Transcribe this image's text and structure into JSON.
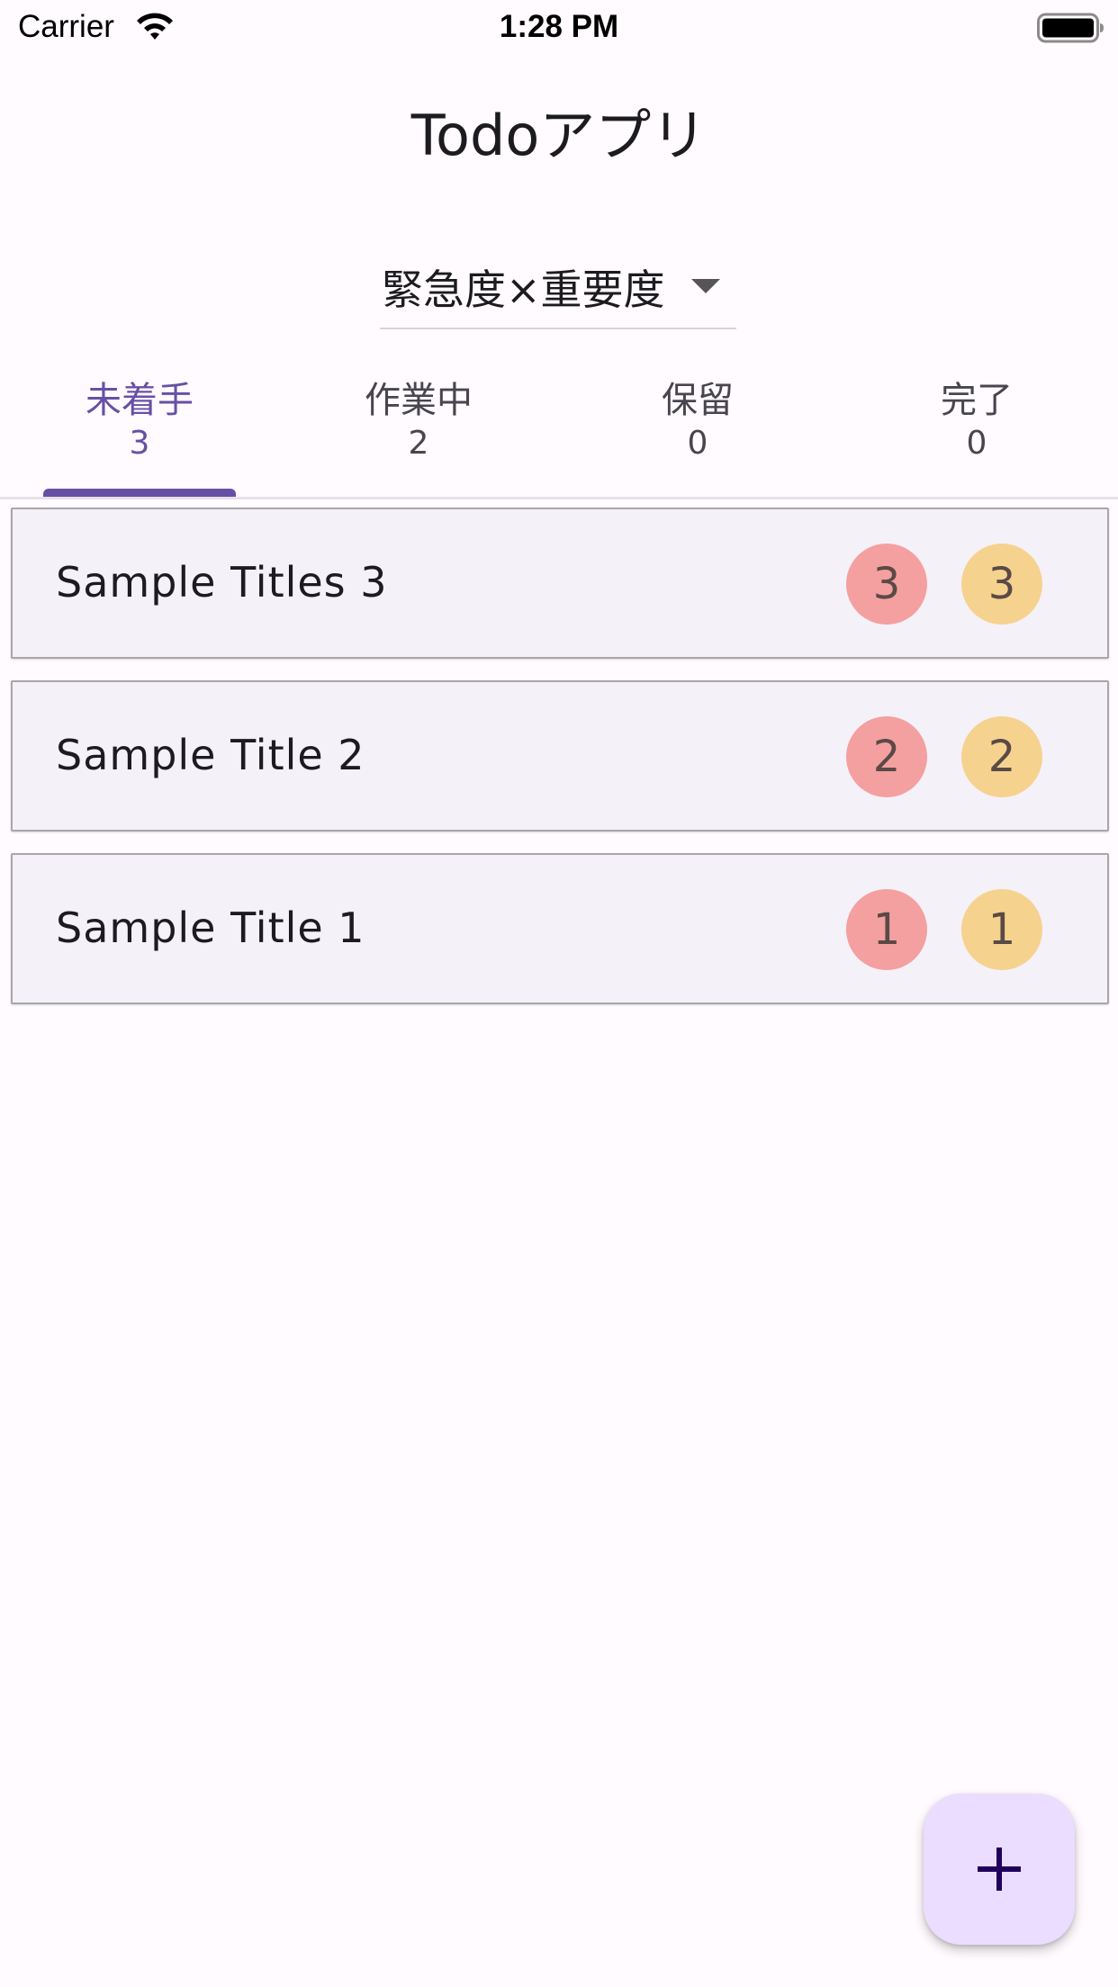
{
  "status_bar": {
    "carrier": "Carrier",
    "time": "1:28 PM",
    "icons": [
      "wifi-icon",
      "battery-icon"
    ]
  },
  "app_bar": {
    "title": "Todoアプリ"
  },
  "sort_dropdown": {
    "selected": "緊急度×重要度",
    "icon": "arrow-drop-down-icon"
  },
  "tabs": [
    {
      "label": "未着手",
      "count": "3",
      "active": true
    },
    {
      "label": "作業中",
      "count": "2",
      "active": false
    },
    {
      "label": "保留",
      "count": "0",
      "active": false
    },
    {
      "label": "完了",
      "count": "0",
      "active": false
    }
  ],
  "tasks": [
    {
      "title": "Sample Titles 3",
      "urgency": "3",
      "importance": "3"
    },
    {
      "title": "Sample Title 2",
      "urgency": "2",
      "importance": "2"
    },
    {
      "title": "Sample Title 1",
      "urgency": "1",
      "importance": "1"
    }
  ],
  "fab": {
    "icon": "plus-icon"
  },
  "colors": {
    "accent": "#6750A4",
    "urgency_badge": "#F4A0A0",
    "importance_badge": "#F6D28F",
    "fab_background": "#EADDFF",
    "card_background": "#F4F1F8"
  }
}
